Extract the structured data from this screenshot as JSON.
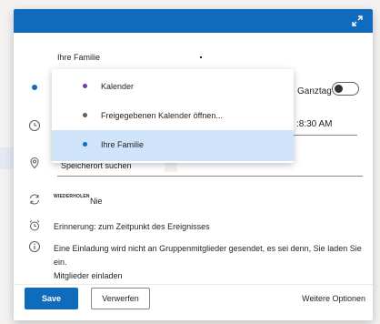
{
  "header": {
    "color": "#0f6cbd",
    "expand_icon": "expand-icon"
  },
  "calendar": {
    "selected": "Ihre Familie"
  },
  "dropdown": {
    "items": [
      {
        "label": "Kalender",
        "dot_color": "#6b3fa0",
        "selected": false
      },
      {
        "label": "Freigegebenen Kalender öffnen...",
        "dot_color": "#605e5c",
        "selected": false
      },
      {
        "label": "Ihre Familie",
        "dot_color": "#0f6cbd",
        "selected": true
      }
    ]
  },
  "all_day": {
    "label": "Ganztag",
    "on": false
  },
  "time": {
    "value": ":8:30 AM"
  },
  "location": {
    "placeholder": "Speicherort suchen"
  },
  "repeat": {
    "tag": "WIEDERHOLEN",
    "value": "Nie"
  },
  "reminder": {
    "text": "Erinnerung: zum Zeitpunkt des Ereignisses"
  },
  "info": {
    "text": "Eine Einladung wird nicht an Gruppenmitglieder gesendet, es sei denn, Sie laden Sie ein.",
    "link": "Mitglieder einladen"
  },
  "footer": {
    "save_label": "Save",
    "discard_label": "Verwerfen",
    "more_label": "Weitere Optionen"
  }
}
